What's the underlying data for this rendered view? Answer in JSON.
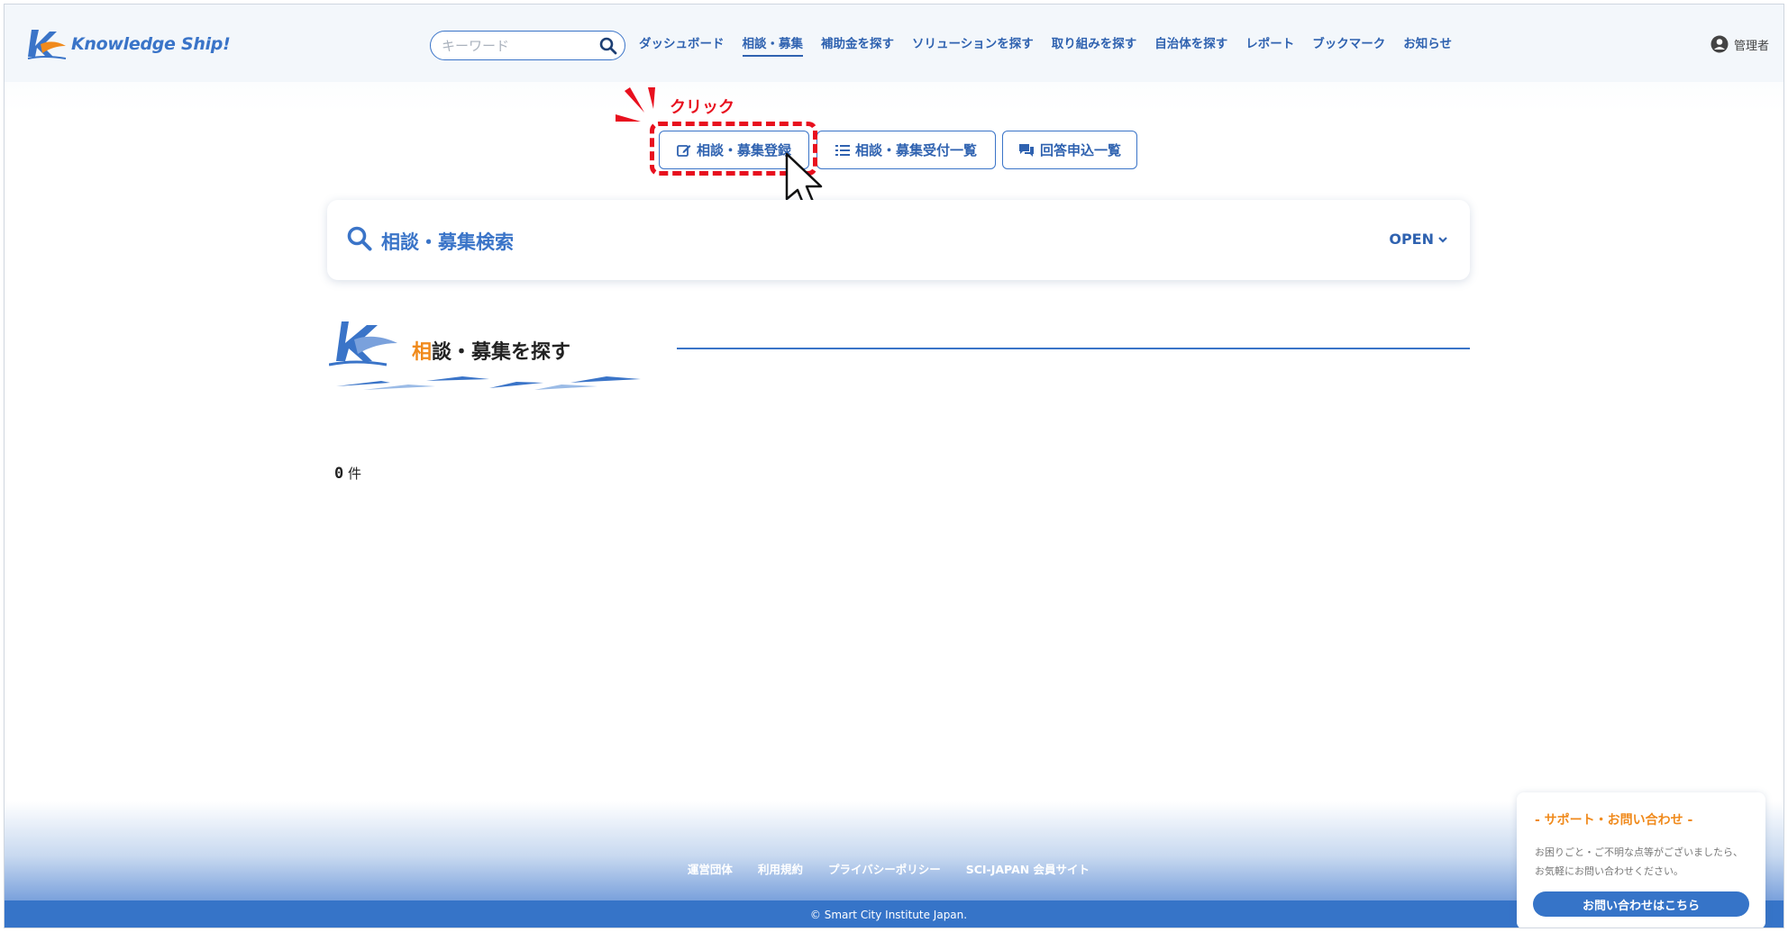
{
  "header": {
    "logo_text": "Knowledge Ship!",
    "search_placeholder": "キーワード",
    "nav": [
      {
        "label": "ダッシュボード"
      },
      {
        "label": "相談・募集"
      },
      {
        "label": "補助金を探す"
      },
      {
        "label": "ソリューションを探す"
      },
      {
        "label": "取り組みを探す"
      },
      {
        "label": "自治体を探す"
      },
      {
        "label": "レポート"
      },
      {
        "label": "ブックマーク"
      },
      {
        "label": "お知らせ"
      }
    ],
    "active_nav": "相談・募集",
    "user_label": "管理者"
  },
  "annotation": {
    "click_label": "クリック",
    "color": "#e8101e"
  },
  "actions": {
    "register_label": "相談・募集登録",
    "list_label": "相談・募集受付一覧",
    "answers_label": "回答申込一覧"
  },
  "search_panel": {
    "title": "相談・募集検索",
    "toggle_label": "OPEN"
  },
  "section": {
    "title_accent": "相",
    "title_rest": "談・募集を探す"
  },
  "results": {
    "count": "0",
    "unit": "件"
  },
  "footer": {
    "links": [
      "運営団体",
      "利用規約",
      "プライバシーポリシー",
      "SCI-JAPAN 会員サイト"
    ],
    "copyright": "© Smart City Institute Japan."
  },
  "support": {
    "title": "- サポート・お問い合わせ -",
    "text": "お困りごと・ご不明な点等がございましたら、お気軽にお問い合わせください。",
    "button_label": "お問い合わせはこちら"
  },
  "colors": {
    "primary": "#3a74c8",
    "accent": "#f08a1c",
    "highlight": "#e8101e"
  }
}
